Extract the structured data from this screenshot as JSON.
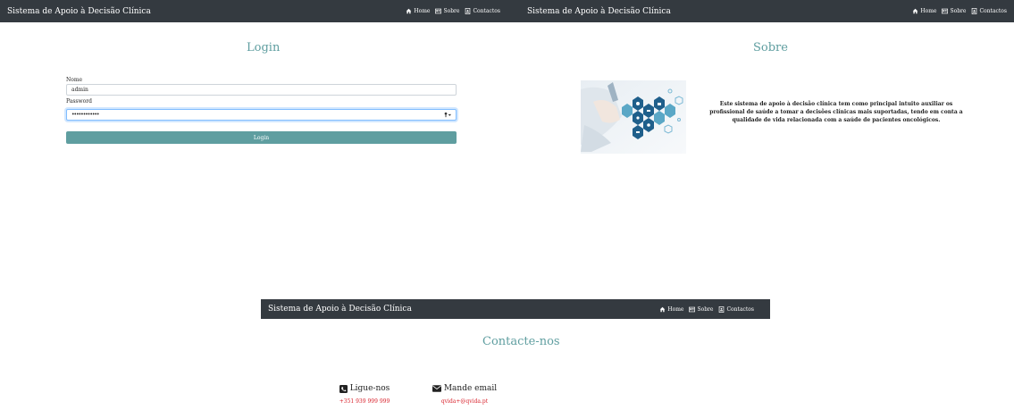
{
  "app": {
    "brand": "Sistema de Apoio à Decisão Clínica"
  },
  "nav": {
    "home": "Home",
    "sobre": "Sobre",
    "contactos": "Contactos"
  },
  "login": {
    "title": "Login",
    "name_label": "Nome",
    "name_value": "admin",
    "password_label": "Password",
    "password_value": "••••••••••••",
    "button": "Login"
  },
  "sobre": {
    "title": "Sobre",
    "text_line1": "Este sistema de apoio à decisão clínica tem como principal intuito auxiliar os",
    "text_line2": "profissional de saúde a tomar a decisões clínicas mais suportadas, tendo em conta a",
    "text_line3": "qualidade de vida relacionada com a saúde de pacientes oncológicos."
  },
  "contact": {
    "title": "Contacte-nos",
    "phone_title": "Ligue-nos",
    "phone_value": "+351 939 999 999",
    "email_title": "Mande email",
    "email_value": "qvida+@qvida.pt"
  },
  "colors": {
    "navbar": "#343a40",
    "accent": "#5f9ea0",
    "contact_value": "#d9232d"
  }
}
